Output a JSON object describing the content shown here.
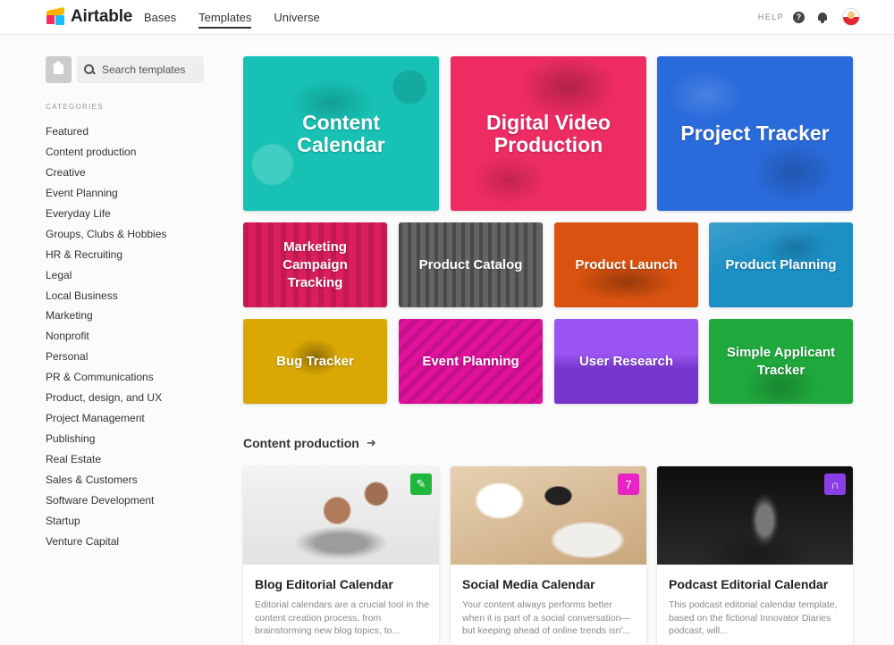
{
  "app": {
    "name": "Airtable"
  },
  "nav": {
    "tabs": [
      "Bases",
      "Templates",
      "Universe"
    ],
    "active": "Templates"
  },
  "header": {
    "help_label": "HELP"
  },
  "sidebar": {
    "search_placeholder": "Search templates",
    "categories_heading": "CATEGORIES",
    "categories": [
      "Featured",
      "Content production",
      "Creative",
      "Event Planning",
      "Everyday Life",
      "Groups, Clubs & Hobbies",
      "HR & Recruiting",
      "Legal",
      "Local Business",
      "Marketing",
      "Nonprofit",
      "Personal",
      "PR & Communications",
      "Product, design, and UX",
      "Project Management",
      "Publishing",
      "Real Estate",
      "Sales & Customers",
      "Software Development",
      "Startup",
      "Venture Capital"
    ]
  },
  "featured": [
    {
      "title": "Content Calendar",
      "color": "#17c2b5"
    },
    {
      "title": "Digital Video Production",
      "color": "#ee2c64"
    },
    {
      "title": "Project Tracker",
      "color": "#2a6bdc"
    },
    {
      "title": "Marketing Campaign Tracking",
      "color": "#dc1e5c"
    },
    {
      "title": "Product Catalog",
      "color": "#5c5c5c"
    },
    {
      "title": "Product Launch",
      "color": "#d9520f"
    },
    {
      "title": "Product Planning",
      "color": "#1c8fc4"
    },
    {
      "title": "Bug Tracker",
      "color": "#d9a804"
    },
    {
      "title": "Event Planning",
      "color": "#e0129c"
    },
    {
      "title": "User Research",
      "color": "#8c3ef0"
    },
    {
      "title": "Simple Applicant Tracker",
      "color": "#1fa83c"
    }
  ],
  "content_section": {
    "title": "Content production",
    "cards": [
      {
        "title": "Blog Editorial Calendar",
        "description": "Editorial calendars are a crucial tool in the content creation process, from brainstorming new blog topics, to...",
        "icon": "pencil-icon",
        "icon_color": "#1fb83c"
      },
      {
        "title": "Social Media Calendar",
        "description": "Your content always performs better when it is part of a social conversation—but keeping ahead of online trends isn'...",
        "icon": "calendar-icon",
        "icon_color": "#e825c2"
      },
      {
        "title": "Podcast Editorial Calendar",
        "description": "This podcast editorial calendar template, based on the fictional Innovator Diaries podcast, will...",
        "icon": "headphones-icon",
        "icon_color": "#8a3ee6"
      }
    ]
  }
}
